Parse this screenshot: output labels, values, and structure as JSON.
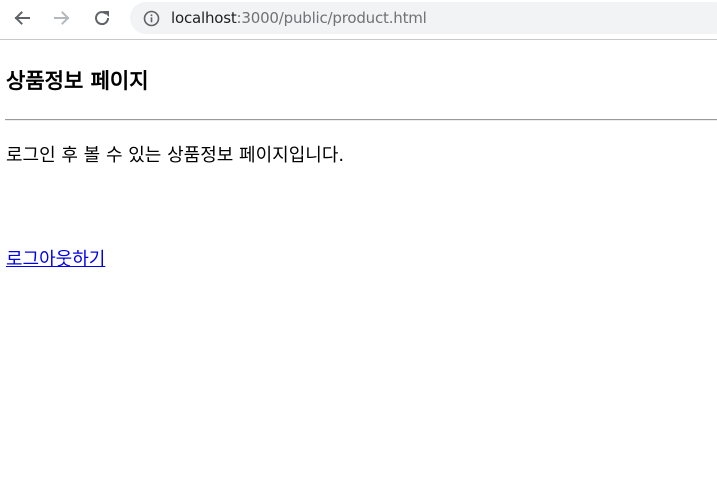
{
  "browser": {
    "url_host": "localhost",
    "url_path": ":3000/public/product.html",
    "icons": {
      "back": "arrow-left-icon",
      "forward": "arrow-right-icon",
      "reload": "reload-icon",
      "info": "info-icon"
    }
  },
  "page": {
    "title": "상품정보 페이지",
    "description": "로그인 후 볼 수 있는 상품정보 페이지입니다.",
    "logout_label": "로그아웃하기"
  },
  "colors": {
    "link": "#0000ee",
    "omnibox_bg": "#f1f3f4"
  }
}
